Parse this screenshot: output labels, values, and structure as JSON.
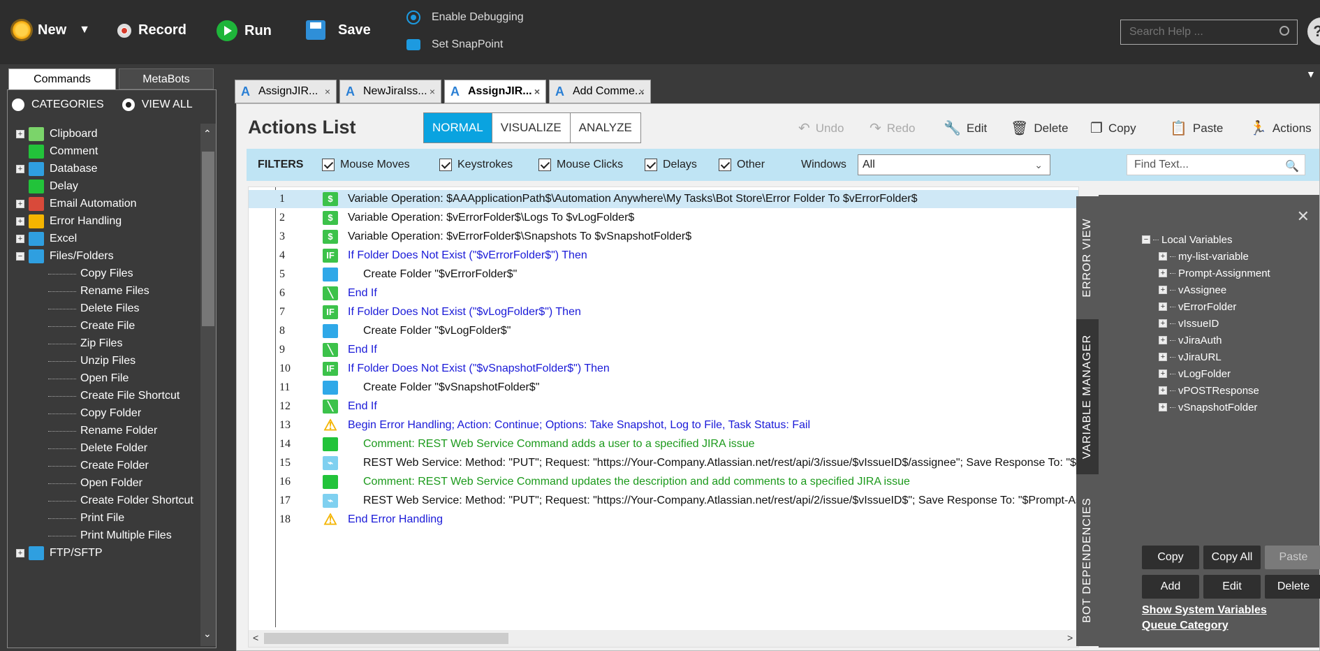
{
  "toolbar": {
    "new_label": "New",
    "record_label": "Record",
    "run_label": "Run",
    "save_label": "Save",
    "enable_debugging": "Enable Debugging",
    "set_snappoint": "Set SnapPoint",
    "search_placeholder": "Search Help ..."
  },
  "left_panel": {
    "tabs": [
      "Commands",
      "MetaBots"
    ],
    "radio_categories": "CATEGORIES",
    "radio_view_all": "VIEW ALL",
    "tree": [
      {
        "label": "Clipboard",
        "icon": "clipboard-icon",
        "color": "#7bd46a",
        "expandable": true
      },
      {
        "label": "Comment",
        "icon": "comment-icon",
        "color": "#22c33a",
        "expandable": false
      },
      {
        "label": "Database",
        "icon": "database-icon",
        "color": "#2f9fe0",
        "expandable": true
      },
      {
        "label": "Delay",
        "icon": "hourglass-icon",
        "color": "#22c33a",
        "expandable": false
      },
      {
        "label": "Email Automation",
        "icon": "email-icon",
        "color": "#d94a3a",
        "expandable": true
      },
      {
        "label": "Error Handling",
        "icon": "warning-icon",
        "color": "#f4b400",
        "expandable": true
      },
      {
        "label": "Excel",
        "icon": "excel-icon",
        "color": "#2f9fe0",
        "expandable": true
      },
      {
        "label": "Files/Folders",
        "icon": "folder-icon",
        "color": "#2f9fe0",
        "expandable": true,
        "expanded": true
      }
    ],
    "files_children": [
      "Copy Files",
      "Rename Files",
      "Delete Files",
      "Create File",
      "Zip Files",
      "Unzip Files",
      "Open File",
      "Create File Shortcut",
      "Copy Folder",
      "Rename Folder",
      "Delete Folder",
      "Create Folder",
      "Open Folder",
      "Create Folder Shortcut",
      "Print File",
      "Print Multiple Files"
    ],
    "last_item": {
      "label": "FTP/SFTP",
      "icon": "ftp-icon"
    }
  },
  "tabs": [
    {
      "label": "AssignJIR...",
      "active": false
    },
    {
      "label": "NewJiraIss...",
      "active": false
    },
    {
      "label": "AssignJIR...",
      "active": true
    },
    {
      "label": "Add Comme...",
      "active": false
    }
  ],
  "main": {
    "title": "Actions List",
    "modes": [
      "NORMAL",
      "VISUALIZE",
      "ANALYZE"
    ],
    "actions": {
      "undo": "Undo",
      "redo": "Redo",
      "edit": "Edit",
      "delete": "Delete",
      "copy": "Copy",
      "paste": "Paste",
      "actions": "Actions"
    }
  },
  "filters": {
    "label": "FILTERS",
    "mouse_moves": "Mouse Moves",
    "keystrokes": "Keystrokes",
    "mouse_clicks": "Mouse Clicks",
    "delays": "Delays",
    "other": "Other",
    "windows_label": "Windows",
    "windows_value": "All",
    "find_placeholder": "Find Text..."
  },
  "rows": [
    {
      "n": "1",
      "icon": "$",
      "iconcolor": "#3cc24a",
      "cls": "black",
      "indent": 0,
      "text": "Variable Operation: $AAApplicationPath$\\Automation Anywhere\\My Tasks\\Bot Store\\Error Folder To $vErrorFolder$"
    },
    {
      "n": "2",
      "icon": "$",
      "iconcolor": "#3cc24a",
      "cls": "black",
      "indent": 0,
      "text": "Variable Operation: $vErrorFolder$\\Logs To $vLogFolder$"
    },
    {
      "n": "3",
      "icon": "$",
      "iconcolor": "#3cc24a",
      "cls": "black",
      "indent": 0,
      "text": "Variable Operation: $vErrorFolder$\\Snapshots To $vSnapshotFolder$"
    },
    {
      "n": "4",
      "icon": "IF",
      "iconcolor": "#3cc24a",
      "cls": "blue",
      "indent": 0,
      "text": "If Folder Does Not Exist (\"$vErrorFolder$\")  Then"
    },
    {
      "n": "5",
      "icon": "",
      "iconcolor": "#2fa8e8",
      "cls": "black",
      "indent": 1,
      "text": "Create Folder \"$vErrorFolder$\""
    },
    {
      "n": "6",
      "icon": "\\",
      "iconcolor": "#3cc24a",
      "cls": "blue",
      "indent": 0,
      "text": "End If"
    },
    {
      "n": "7",
      "icon": "IF",
      "iconcolor": "#3cc24a",
      "cls": "blue",
      "indent": 0,
      "text": "If Folder Does Not Exist (\"$vLogFolder$\")  Then"
    },
    {
      "n": "8",
      "icon": "",
      "iconcolor": "#2fa8e8",
      "cls": "black",
      "indent": 1,
      "text": "Create Folder \"$vLogFolder$\""
    },
    {
      "n": "9",
      "icon": "\\",
      "iconcolor": "#3cc24a",
      "cls": "blue",
      "indent": 0,
      "text": "End If"
    },
    {
      "n": "10",
      "icon": "IF",
      "iconcolor": "#3cc24a",
      "cls": "blue",
      "indent": 0,
      "text": "If Folder Does Not Exist (\"$vSnapshotFolder$\")  Then"
    },
    {
      "n": "11",
      "icon": "",
      "iconcolor": "#2fa8e8",
      "cls": "black",
      "indent": 1,
      "text": "Create Folder \"$vSnapshotFolder$\""
    },
    {
      "n": "12",
      "icon": "\\",
      "iconcolor": "#3cc24a",
      "cls": "blue",
      "indent": 0,
      "text": "End If"
    },
    {
      "n": "13",
      "icon": "!",
      "iconcolor": "#f4b400",
      "cls": "blue",
      "indent": 0,
      "text": "Begin Error Handling; Action: Continue; Options: Take Snapshot, Log to File,  Task Status: Fail"
    },
    {
      "n": "14",
      "icon": "",
      "iconcolor": "#22c33a",
      "cls": "green",
      "indent": 1,
      "text": "Comment: REST Web Service Command adds a user to a specified JIRA issue"
    },
    {
      "n": "15",
      "icon": "~",
      "iconcolor": "#7fd0f0",
      "cls": "black",
      "indent": 1,
      "text": "REST Web Service: Method: \"PUT\"; Request: \"https://Your-Company.Atlassian.net/rest/api/3/issue/$vIssueID$/assignee\"; Save Response To: \"$Prompt-Assignment$\""
    },
    {
      "n": "16",
      "icon": "",
      "iconcolor": "#22c33a",
      "cls": "green",
      "indent": 1,
      "text": "Comment: REST Web Service Command updates the description and add comments to a specified JIRA issue"
    },
    {
      "n": "17",
      "icon": "~",
      "iconcolor": "#7fd0f0",
      "cls": "black",
      "indent": 1,
      "text": "REST Web Service: Method: \"PUT\"; Request: \"https://Your-Company.Atlassian.net/rest/api/2/issue/$vIssueID$\"; Save Response To: \"$Prompt-Assignment$\""
    },
    {
      "n": "18",
      "icon": "!",
      "iconcolor": "#f4b400",
      "cls": "blue",
      "indent": 0,
      "text": "End Error Handling"
    }
  ],
  "side_tabs": [
    "ERROR VIEW",
    "VARIABLE MANAGER",
    "BOT DEPENDENCIES"
  ],
  "variables": {
    "root": "Local Variables",
    "items": [
      "my-list-variable",
      "Prompt-Assignment",
      "vAssignee",
      "vErrorFolder",
      "vIssueID",
      "vJiraAuth",
      "vJiraURL",
      "vLogFolder",
      "vPOSTResponse",
      "vSnapshotFolder"
    ],
    "buttons": {
      "copy": "Copy",
      "copy_all": "Copy All",
      "paste": "Paste",
      "add": "Add",
      "edit": "Edit",
      "delete": "Delete"
    },
    "show_system": "Show System Variables",
    "queue_category": "Queue Category"
  }
}
